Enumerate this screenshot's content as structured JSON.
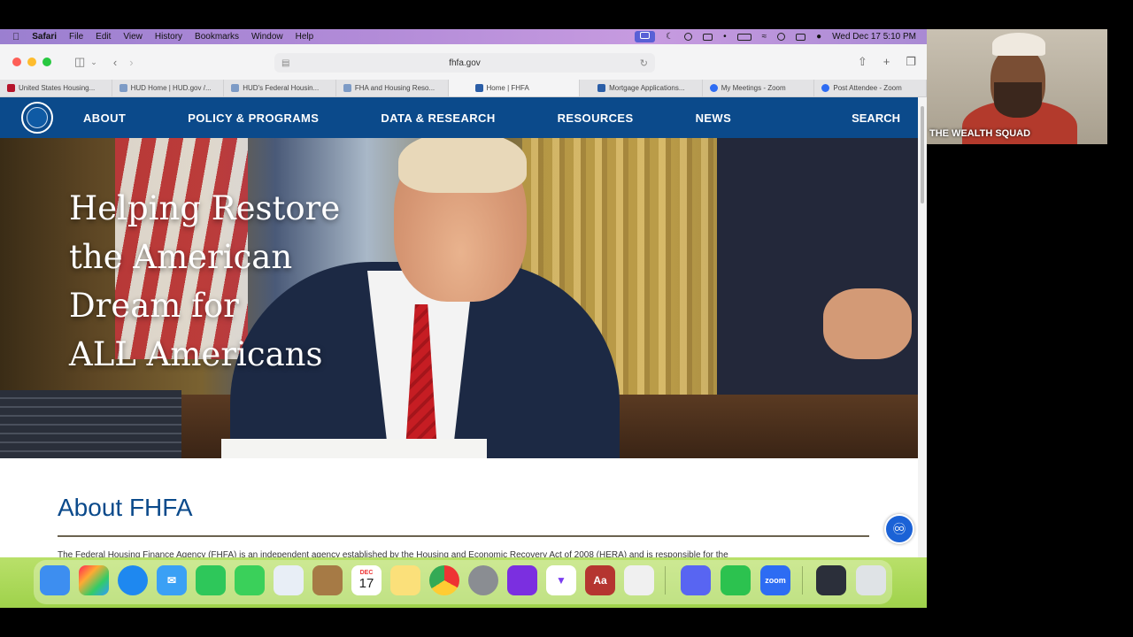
{
  "menubar": {
    "app": "Safari",
    "items": [
      "File",
      "Edit",
      "View",
      "History",
      "Bookmarks",
      "Window",
      "Help"
    ],
    "datetime": "Wed Dec 17  5:10 PM"
  },
  "toolbar": {
    "url": "fhfa.gov"
  },
  "tabs": [
    {
      "label": "United States Housing...",
      "icon_color": "#b5142b"
    },
    {
      "label": "HUD Home | HUD.gov /...",
      "icon_color": "#7d9bc6"
    },
    {
      "label": "HUD's Federal Housin...",
      "icon_color": "#7d9bc6"
    },
    {
      "label": "FHA and Housing Reso...",
      "icon_color": "#7d9bc6"
    },
    {
      "label": "Home | FHFA",
      "icon_color": "#2b5ea7"
    },
    {
      "label": "Mortgage Applications...",
      "icon_color": "#2b5ea7"
    },
    {
      "label": "My Meetings - Zoom",
      "icon_color": "#2d6cf3"
    },
    {
      "label": "Post Attendee - Zoom",
      "icon_color": "#2d6cf3"
    }
  ],
  "nav": {
    "links": [
      "ABOUT",
      "POLICY & PROGRAMS",
      "DATA & RESEARCH",
      "RESOURCES",
      "NEWS"
    ],
    "search": "SEARCH"
  },
  "hero": {
    "line1": "Helping Restore",
    "line2": "the American",
    "line3": "Dream for",
    "line4": "ALL Americans"
  },
  "about": {
    "heading": "About FHFA",
    "body": "The Federal Housing Finance Agency (FHFA) is an independent agency established by the Housing and Economic Recovery Act of 2008 (HERA) and is responsible for the"
  },
  "dock": {
    "calendar_month": "DEC",
    "calendar_day": "17",
    "zoom_label": "zoom",
    "dictionary_label": "Aa"
  },
  "webcam": {
    "name": "THE WEALTH SQUAD"
  },
  "colors": {
    "nav_blue": "#0b4a8b",
    "accent_blue": "#1b62d6"
  }
}
